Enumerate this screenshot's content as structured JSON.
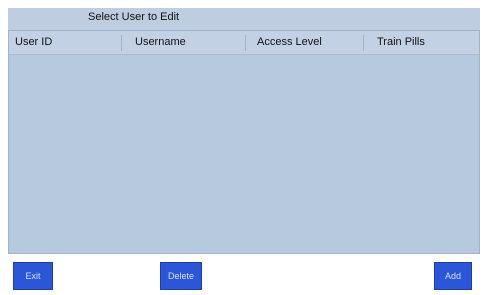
{
  "title": "Select User to Edit",
  "table": {
    "columns": [
      "User ID",
      "Username",
      "Access Level",
      "Train Pills"
    ],
    "rows": []
  },
  "buttons": {
    "exit": "Exit",
    "delete": "Delete",
    "add": "Add"
  },
  "colors": {
    "title_bar": "#bfcde0",
    "grid_bg": "#b7c9df",
    "button_bg": "#2b56d8"
  }
}
